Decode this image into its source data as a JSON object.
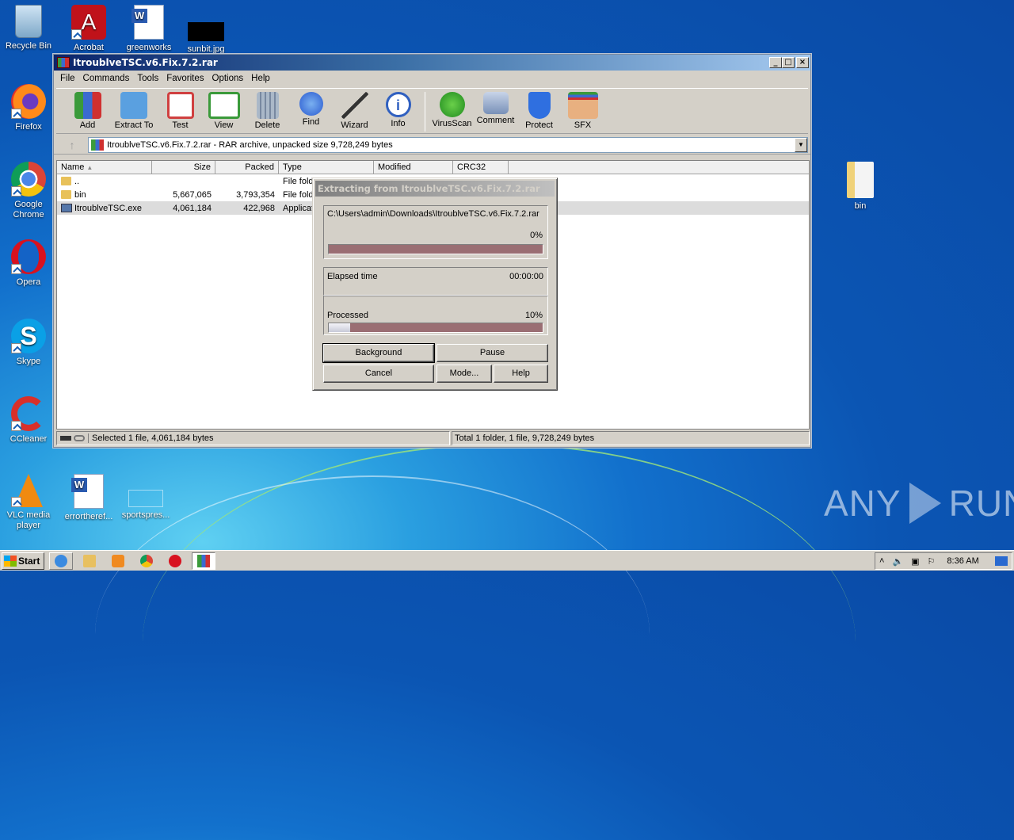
{
  "desktop": {
    "icons": [
      {
        "name": "Recycle Bin",
        "icon": "recycle-bin-icon"
      },
      {
        "name": "Acrobat",
        "icon": "acrobat-icon"
      },
      {
        "name": "greenworks",
        "icon": "word-doc-icon"
      },
      {
        "name": "sunbit.jpg",
        "icon": "image-thumbnail-icon"
      },
      {
        "name": "Firefox",
        "icon": "firefox-icon"
      },
      {
        "name": "Google Chrome",
        "icon": "chrome-icon"
      },
      {
        "name": "Opera",
        "icon": "opera-icon"
      },
      {
        "name": "Skype",
        "icon": "skype-icon"
      },
      {
        "name": "CCleaner",
        "icon": "ccleaner-icon"
      },
      {
        "name": "VLC media player",
        "icon": "vlc-icon"
      },
      {
        "name": "errortheref...",
        "icon": "word-doc-icon"
      },
      {
        "name": "sportspres...",
        "icon": "blank-file-icon"
      },
      {
        "name": "bin",
        "icon": "folder-icon"
      }
    ],
    "watermark": {
      "left": "ANY",
      "right": "RUN"
    }
  },
  "window": {
    "title": "ItroublveTSC.v6.Fix.7.2.rar",
    "controls": {
      "minimize": "_",
      "maximize": "□",
      "close": "×"
    },
    "menu": [
      "File",
      "Commands",
      "Tools",
      "Favorites",
      "Options",
      "Help"
    ],
    "toolbar": [
      {
        "label": "Add",
        "icon": "add-archive-icon",
        "color": "#c8402a"
      },
      {
        "label": "Extract To",
        "icon": "extract-folder-icon",
        "color": "#5aa0e0"
      },
      {
        "label": "Test",
        "icon": "test-clipboard-icon",
        "color": "#d04040"
      },
      {
        "label": "View",
        "icon": "view-book-icon",
        "color": "#3a9a3a"
      },
      {
        "label": "Delete",
        "icon": "trash-icon",
        "color": "#8090a8"
      },
      {
        "label": "Find",
        "icon": "magnifier-icon",
        "color": "#2a6ad0"
      },
      {
        "label": "Wizard",
        "icon": "wand-icon",
        "color": "#6a6a6a"
      },
      {
        "label": "Info",
        "icon": "info-icon",
        "color": "#3060c0"
      },
      {
        "label": "VirusScan",
        "icon": "virus-scan-icon",
        "color": "#3aa83a"
      },
      {
        "label": "Comment",
        "icon": "comment-icon",
        "color": "#7890b8"
      },
      {
        "label": "Protect",
        "icon": "shield-icon",
        "color": "#2f6fe0"
      },
      {
        "label": "SFX",
        "icon": "sfx-box-icon",
        "color": "#e0a070"
      }
    ],
    "address": "ItroublveTSC.v6.Fix.7.2.rar - RAR archive, unpacked size 9,728,249 bytes",
    "columns": [
      "Name",
      "Size",
      "Packed",
      "Type",
      "Modified",
      "CRC32"
    ],
    "rows": [
      {
        "name": "..",
        "size": "",
        "packed": "",
        "type": "File fold",
        "icon": "folder-icon"
      },
      {
        "name": "bin",
        "size": "5,667,065",
        "packed": "3,793,354",
        "type": "File fold",
        "icon": "folder-icon"
      },
      {
        "name": "ItroublveTSC.exe",
        "size": "4,061,184",
        "packed": "422,968",
        "type": "Applicat",
        "icon": "exe-icon"
      }
    ],
    "status_left": "Selected 1 file, 4,061,184 bytes",
    "status_right": "Total 1 folder, 1 file, 9,728,249 bytes"
  },
  "dialog": {
    "title": "Extracting from ItroublveTSC.v6.Fix.7.2.rar",
    "path": "C:\\Users\\admin\\Downloads\\ItroublveTSC.v6.Fix.7.2.rar",
    "file_percent_label": "0%",
    "file_progress": 0,
    "elapsed_label": "Elapsed time",
    "elapsed_value": "00:00:00",
    "processed_label": "Processed",
    "processed_percent_label": "10%",
    "processed_progress": 0.1,
    "buttons": {
      "background": "Background",
      "pause": "Pause",
      "cancel": "Cancel",
      "mode": "Mode...",
      "help": "Help"
    }
  },
  "taskbar": {
    "start": "Start",
    "items": [
      "internet-explorer-icon",
      "explorer-icon",
      "media-player-icon",
      "chrome-icon",
      "opera-icon",
      "winrar-icon"
    ],
    "clock": "8:36 AM"
  }
}
